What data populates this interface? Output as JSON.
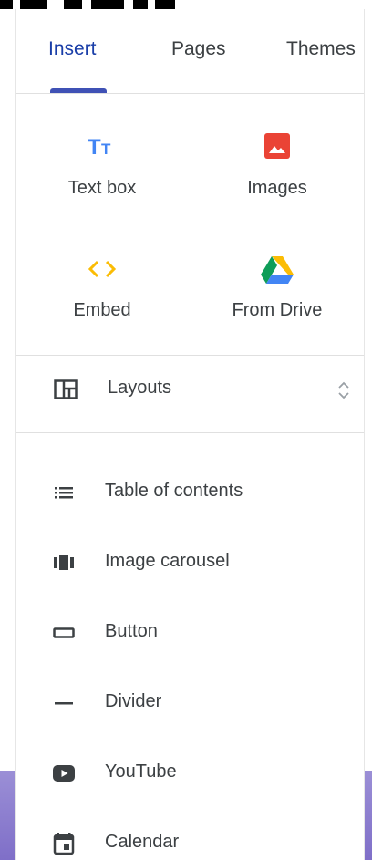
{
  "tabs": [
    {
      "label": "Insert",
      "active": true
    },
    {
      "label": "Pages",
      "active": false
    },
    {
      "label": "Themes",
      "active": false
    }
  ],
  "insert_items": [
    {
      "label": "Text box",
      "icon": "text-box-icon"
    },
    {
      "label": "Images",
      "icon": "image-icon"
    },
    {
      "label": "Embed",
      "icon": "embed-icon"
    },
    {
      "label": "From Drive",
      "icon": "google-drive-icon"
    }
  ],
  "layouts": {
    "label": "Layouts",
    "icon": "layout-icon",
    "toggle_icon": "unfold-icon"
  },
  "components": [
    {
      "label": "Table of contents",
      "icon": "list-icon"
    },
    {
      "label": "Image carousel",
      "icon": "carousel-icon"
    },
    {
      "label": "Button",
      "icon": "button-icon"
    },
    {
      "label": "Divider",
      "icon": "divider-icon"
    },
    {
      "label": "YouTube",
      "icon": "youtube-icon"
    },
    {
      "label": "Calendar",
      "icon": "calendar-icon"
    }
  ],
  "colors": {
    "active_tab": "#1a3ea8",
    "indicator": "#3f51b5",
    "text_box_icon": "#4285f4",
    "images_icon": "#ea4335",
    "embed_icon": "#fbbc04",
    "icon_dark": "#3c4043"
  }
}
